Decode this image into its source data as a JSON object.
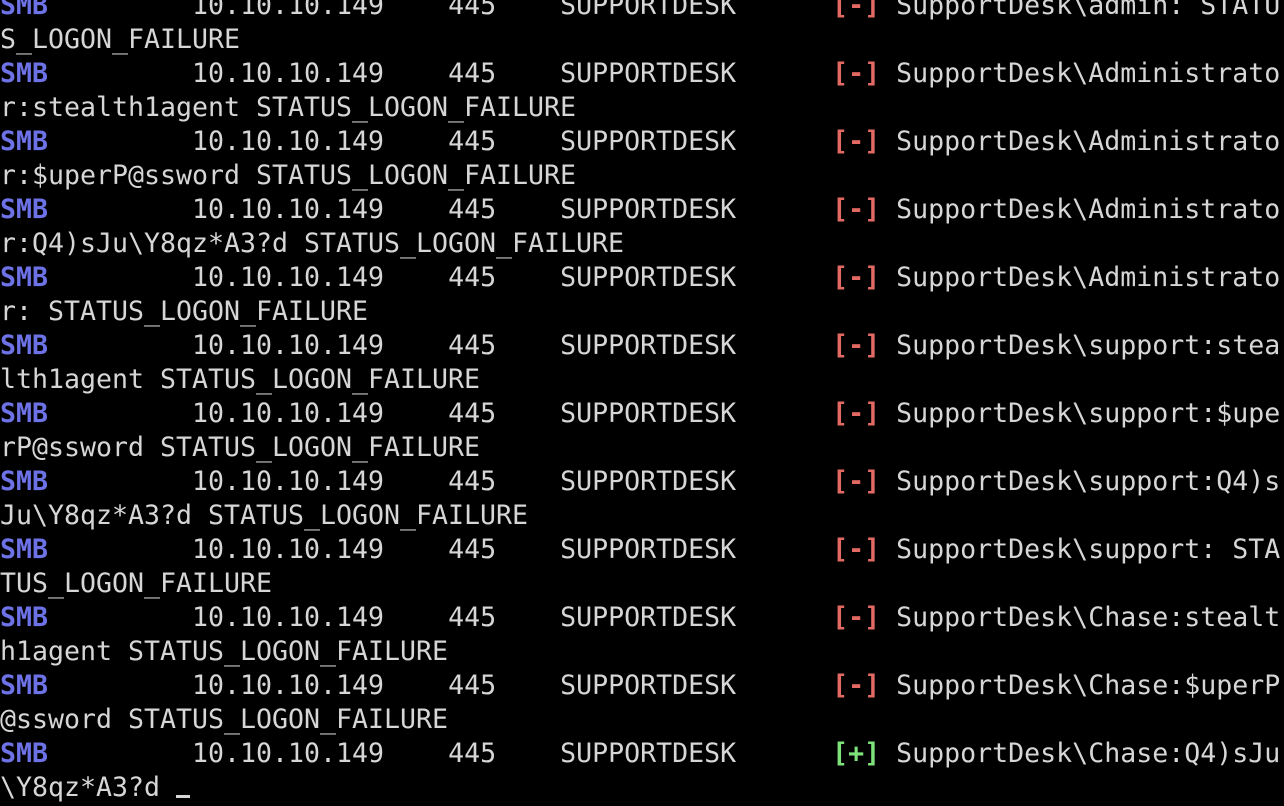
{
  "terminal": {
    "colors": {
      "protocol": "#6d73e6",
      "failure": "#e36a62",
      "success": "#7de27a",
      "text": "#d6d6d6",
      "background": "#000000"
    },
    "records": [
      {
        "protocol": "SMB",
        "host": "10.10.10.149",
        "port": "445",
        "name": "SUPPORTDESK",
        "status": "[-]",
        "message": "SupportDesk\\admin: STATUS_LOGON_FAILURE"
      },
      {
        "protocol": "SMB",
        "host": "10.10.10.149",
        "port": "445",
        "name": "SUPPORTDESK",
        "status": "[-]",
        "message": "SupportDesk\\Administrator:stealth1agent STATUS_LOGON_FAILURE"
      },
      {
        "protocol": "SMB",
        "host": "10.10.10.149",
        "port": "445",
        "name": "SUPPORTDESK",
        "status": "[-]",
        "message": "SupportDesk\\Administrator:$uperP@ssword STATUS_LOGON_FAILURE"
      },
      {
        "protocol": "SMB",
        "host": "10.10.10.149",
        "port": "445",
        "name": "SUPPORTDESK",
        "status": "[-]",
        "message": "SupportDesk\\Administrator:Q4)sJu\\Y8qz*A3?d STATUS_LOGON_FAILURE"
      },
      {
        "protocol": "SMB",
        "host": "10.10.10.149",
        "port": "445",
        "name": "SUPPORTDESK",
        "status": "[-]",
        "message": "SupportDesk\\Administrator: STATUS_LOGON_FAILURE"
      },
      {
        "protocol": "SMB",
        "host": "10.10.10.149",
        "port": "445",
        "name": "SUPPORTDESK",
        "status": "[-]",
        "message": "SupportDesk\\support:stealth1agent STATUS_LOGON_FAILURE"
      },
      {
        "protocol": "SMB",
        "host": "10.10.10.149",
        "port": "445",
        "name": "SUPPORTDESK",
        "status": "[-]",
        "message": "SupportDesk\\support:$uperP@ssword STATUS_LOGON_FAILURE"
      },
      {
        "protocol": "SMB",
        "host": "10.10.10.149",
        "port": "445",
        "name": "SUPPORTDESK",
        "status": "[-]",
        "message": "SupportDesk\\support:Q4)sJu\\Y8qz*A3?d STATUS_LOGON_FAILURE"
      },
      {
        "protocol": "SMB",
        "host": "10.10.10.149",
        "port": "445",
        "name": "SUPPORTDESK",
        "status": "[-]",
        "message": "SupportDesk\\support: STATUS_LOGON_FAILURE"
      },
      {
        "protocol": "SMB",
        "host": "10.10.10.149",
        "port": "445",
        "name": "SUPPORTDESK",
        "status": "[-]",
        "message": "SupportDesk\\Chase:stealth1agent STATUS_LOGON_FAILURE"
      },
      {
        "protocol": "SMB",
        "host": "10.10.10.149",
        "port": "445",
        "name": "SUPPORTDESK",
        "status": "[-]",
        "message": "SupportDesk\\Chase:$uperP@ssword STATUS_LOGON_FAILURE"
      },
      {
        "protocol": "SMB",
        "host": "10.10.10.149",
        "port": "445",
        "name": "SUPPORTDESK",
        "status": "[+]",
        "message": "SupportDesk\\Chase:Q4)sJu\\Y8qz*A3?d "
      }
    ]
  }
}
